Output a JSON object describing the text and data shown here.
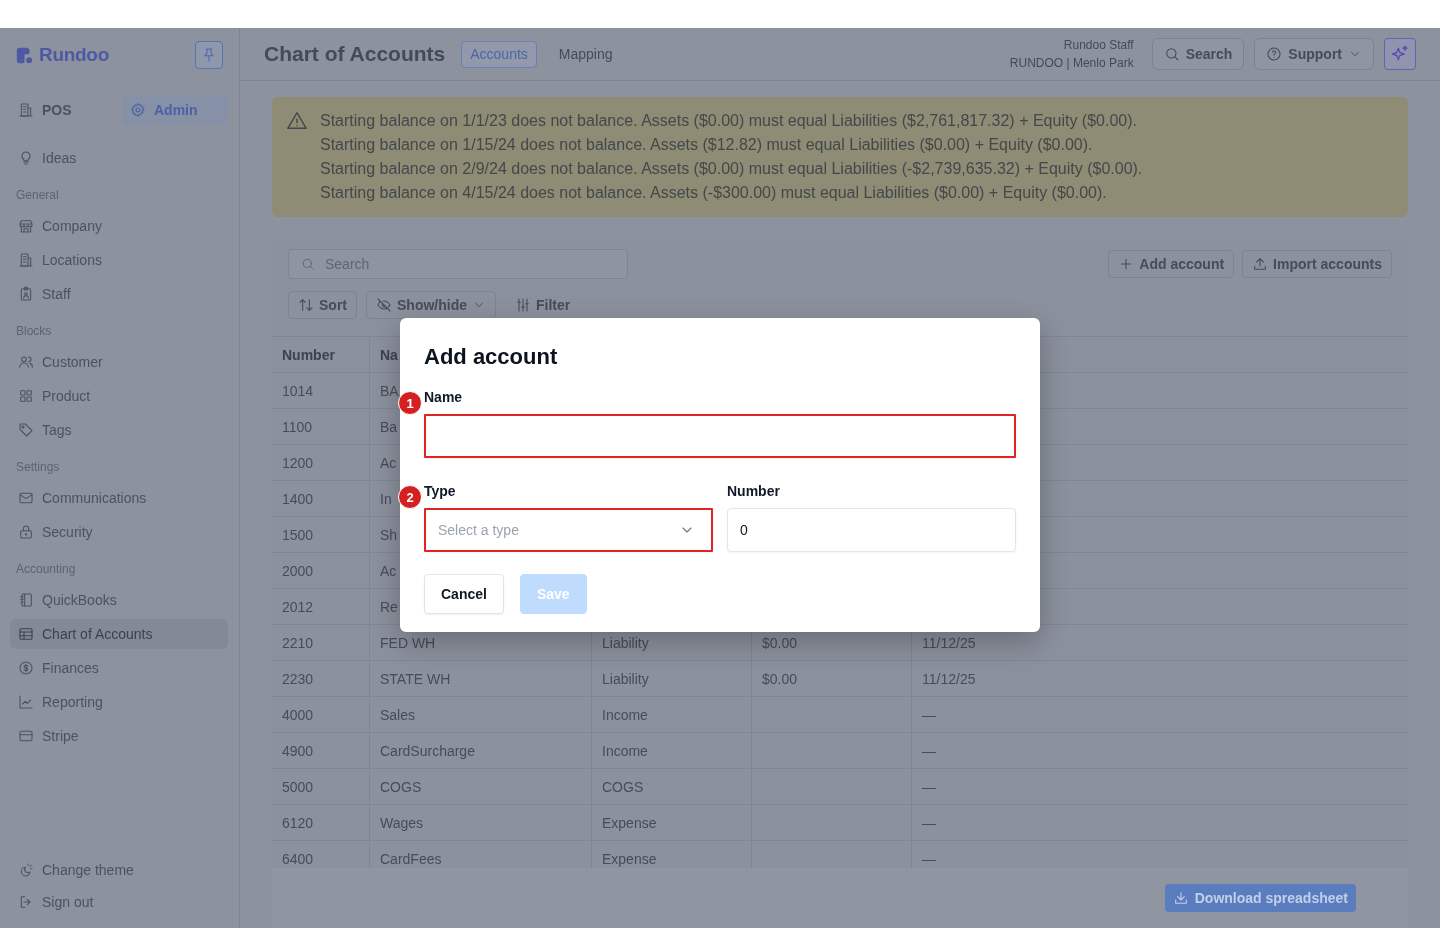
{
  "sidebar": {
    "logo": "Rundoo",
    "modes": [
      {
        "label": "POS",
        "selected": false
      },
      {
        "label": "Admin",
        "selected": true
      }
    ],
    "sections": [
      {
        "items": [
          {
            "label": "Ideas",
            "selected": false
          }
        ]
      },
      {
        "heading": "General",
        "items": [
          {
            "label": "Company",
            "selected": false
          },
          {
            "label": "Locations",
            "selected": false
          },
          {
            "label": "Staff",
            "selected": false
          }
        ]
      },
      {
        "heading": "Blocks",
        "items": [
          {
            "label": "Customer",
            "selected": false
          },
          {
            "label": "Product",
            "selected": false
          },
          {
            "label": "Tags",
            "selected": false
          }
        ]
      },
      {
        "heading": "Settings",
        "items": [
          {
            "label": "Communications",
            "selected": false
          },
          {
            "label": "Security",
            "selected": false
          }
        ]
      },
      {
        "heading": "Accounting",
        "items": [
          {
            "label": "QuickBooks",
            "selected": false
          },
          {
            "label": "Chart of Accounts",
            "selected": true
          },
          {
            "label": "Finances",
            "selected": false
          },
          {
            "label": "Reporting",
            "selected": false
          },
          {
            "label": "Stripe",
            "selected": false
          }
        ]
      }
    ],
    "footer": [
      "Change theme",
      "Sign out"
    ]
  },
  "header": {
    "title": "Chart of Accounts",
    "tabs": [
      {
        "label": "Accounts",
        "selected": true
      },
      {
        "label": "Mapping",
        "selected": false
      }
    ],
    "user": "Rundoo Staff",
    "store": "RUNDOO | Menlo Park",
    "buttons": [
      {
        "label": "Search",
        "kind": "plain"
      },
      {
        "label": "Support",
        "kind": "dropdown"
      }
    ]
  },
  "alert": {
    "kind": "warning",
    "lines": [
      "Starting balance on 1/1/23 does not balance. Assets ($0.00) must equal Liabilities ($2,761,817.32) + Equity ($0.00).",
      "Starting balance on 1/15/24 does not balance. Assets ($12.82) must equal Liabilities ($0.00) + Equity ($0.00).",
      "Starting balance on 2/9/24 does not balance. Assets ($0.00) must equal Liabilities (-$2,739,635.32) + Equity ($0.00).",
      "Starting balance on 4/15/24 does not balance. Assets (-$300.00) must equal Liabilities ($0.00) + Equity ($0.00)."
    ]
  },
  "toolbar": {
    "search": {
      "placeholder": "Search"
    },
    "actions": [
      "Add account",
      "Import accounts"
    ],
    "views": [
      {
        "label": "Sort",
        "kind": "outlined"
      },
      {
        "label": "Show/hide",
        "kind": "dropdown"
      },
      {
        "label": "Filter",
        "kind": "plain"
      }
    ]
  },
  "table": {
    "columns": [
      "Number",
      "Na"
    ],
    "rows": [
      {
        "column_1": "1014",
        "column_2": "BA"
      },
      {
        "column_1": "1100",
        "column_2": "Ba"
      },
      {
        "column_1": "1200",
        "column_2": "Ac"
      },
      {
        "column_1": "1400",
        "column_2": "In"
      },
      {
        "column_1": "1500",
        "column_2": "Sh"
      },
      {
        "column_1": "2000",
        "column_2": "Ac"
      },
      {
        "column_1": "2012",
        "column_2": "Re"
      },
      {
        "column_1": "2210",
        "column_2": "FED WH",
        "column_3": "Liability",
        "column_4": "$0.00",
        "column_5": "11/12/25"
      },
      {
        "column_1": "2230",
        "column_2": "STATE WH",
        "column_3": "Liability",
        "column_4": "$0.00",
        "column_5": "11/12/25"
      },
      {
        "column_1": "4000",
        "column_2": "Sales",
        "column_3": "Income",
        "column_5": "—"
      },
      {
        "column_1": "4900",
        "column_2": "CardSurcharge",
        "column_3": "Income",
        "column_5": "—"
      },
      {
        "column_1": "5000",
        "column_2": "COGS",
        "column_3": "COGS",
        "column_5": "—"
      },
      {
        "column_1": "6120",
        "column_2": "Wages",
        "column_3": "Expense",
        "column_5": "—"
      },
      {
        "column_1": "6400",
        "column_2": "CardFees",
        "column_3": "Expense",
        "column_5": "—"
      }
    ]
  },
  "download_button": "Download spreadsheet",
  "dialog": {
    "title": "Add account",
    "fields": [
      {
        "kind": "text",
        "label": "Name",
        "marker": "1",
        "highlighted": true
      },
      {
        "kind": "select",
        "label": "Type",
        "placeholder": "Select a type",
        "marker": "2",
        "highlighted": true
      },
      {
        "kind": "text",
        "label": "Number",
        "value": "0",
        "highlighted": false
      }
    ],
    "buttons": [
      {
        "label": "Cancel",
        "kind": "secondary",
        "disabled": false
      },
      {
        "label": "Save",
        "kind": "primary",
        "disabled": true
      }
    ]
  }
}
